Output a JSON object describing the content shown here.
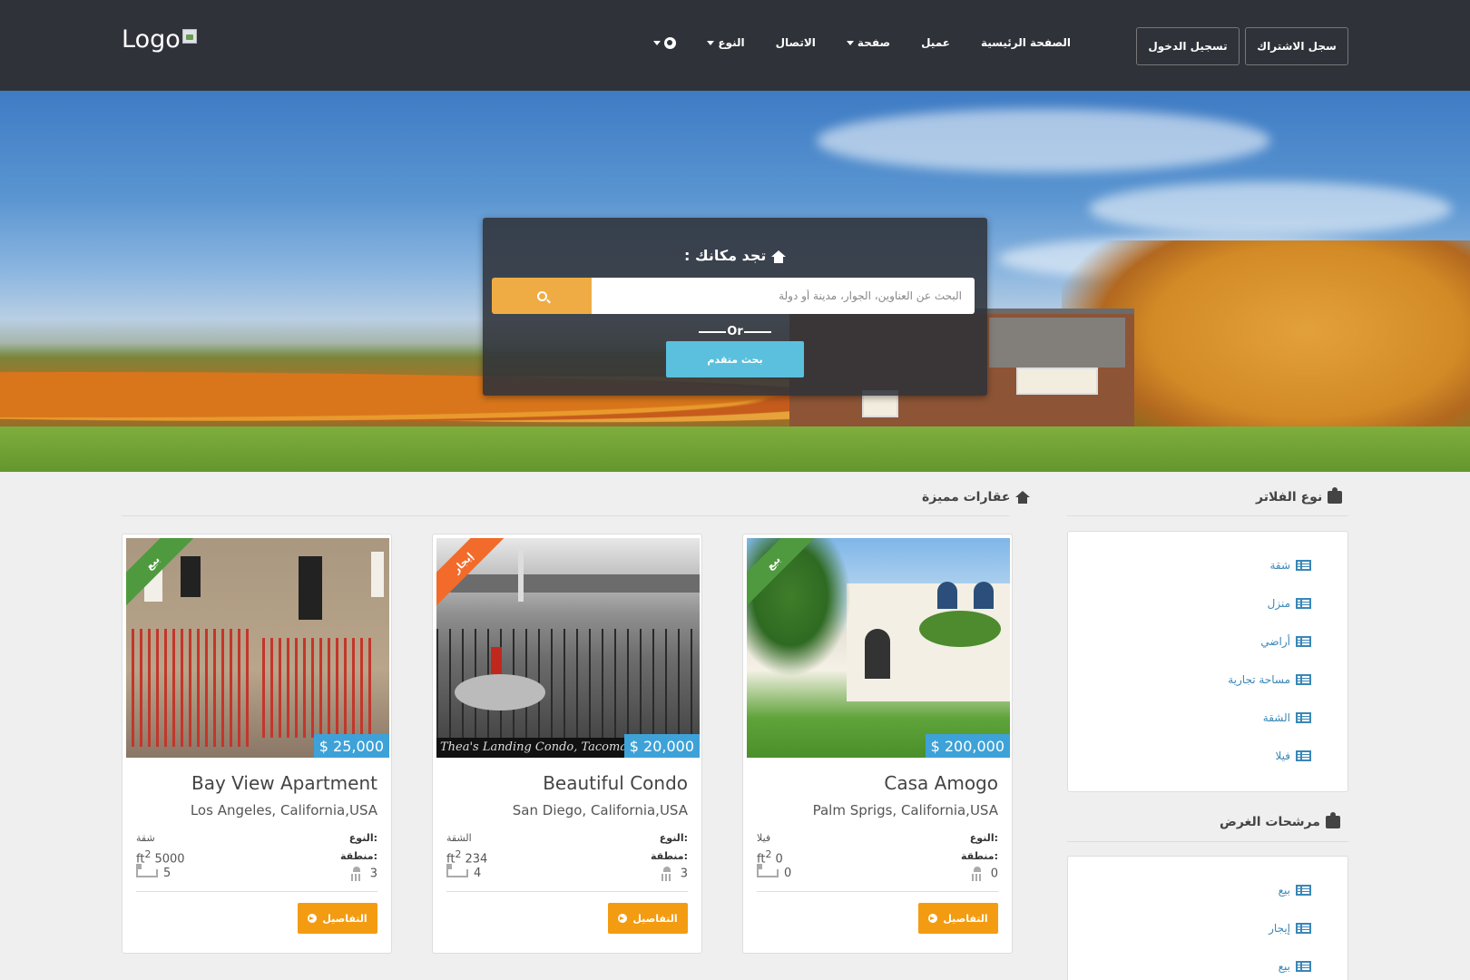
{
  "nav": {
    "logo_text": "Logo",
    "links": [
      "الصفحة الرئيسية",
      "عميل",
      "صفحة",
      "الاتصال",
      "النوع"
    ],
    "signup": "سجل الاشتراك",
    "login": "تسجيل الدخول"
  },
  "search": {
    "title": "تجد مكانك :",
    "placeholder": "البحث عن العناوين، الجوار، مدينة أو دولة",
    "or_text": "Or",
    "advanced": "بحث متقدم"
  },
  "featured": {
    "title": "عقارات مميزة",
    "type_label": "النوع:",
    "area_label": "منطقة:",
    "details_label": "التفاصيل",
    "area_unit": "ft",
    "listings": [
      {
        "title": "Casa Amogo",
        "location": "Palm Sprigs, California,USA",
        "price": "$ 200,000",
        "ribbon": "بيع",
        "type": "فيلا",
        "area": "0",
        "beds": "0",
        "baths": "0",
        "ribbon_color": "#4f9a3f"
      },
      {
        "title": "Beautiful Condo",
        "location": "San Diego, California,USA",
        "price": "$ 20,000",
        "ribbon": "إيجار",
        "type": "الشقة",
        "area": "234",
        "beds": "4",
        "baths": "3",
        "ribbon_color": "#f26b2a",
        "watermark": "Thea's Landing Condo, Tacoma"
      },
      {
        "title": "Bay View Apartment",
        "location": "Los Angeles, California,USA",
        "price": "$ 25,000",
        "ribbon": "بيع",
        "type": "شقة",
        "area": "5000",
        "beds": "5",
        "baths": "3",
        "ribbon_color": "#4f9a3f"
      }
    ]
  },
  "sidebar": {
    "types_title": "نوع الفلاتر",
    "types": [
      "شقة",
      "منزل",
      "أراضي",
      "مساحة تجارية",
      "الشقة",
      "فيلا"
    ],
    "purpose_title": "مرشحات الغرض",
    "purposes": [
      "بيع",
      "إيجار",
      "بيع"
    ]
  },
  "colors": {
    "navbar": "#2f3239",
    "accent_orange": "#efac45",
    "accent_blue": "#5bc0de",
    "price_blue": "#3ea2d8",
    "details_orange": "#f39c12",
    "link_blue": "#3a87b7"
  },
  "icons": [
    "globe-icon",
    "home-icon",
    "search-icon",
    "puzzle-icon",
    "list-icon",
    "bed-icon",
    "shower-icon",
    "arrow-circle-icon"
  ]
}
